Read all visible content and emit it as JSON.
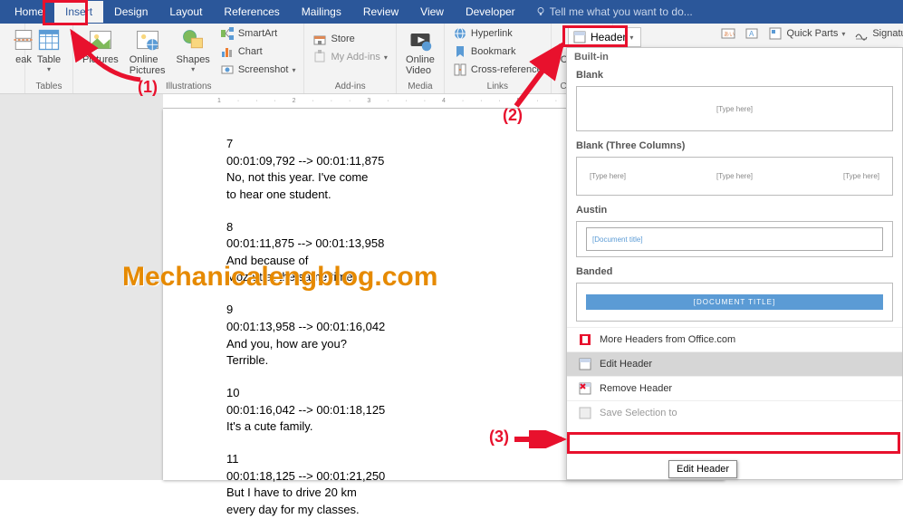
{
  "tabs": [
    "Home",
    "Insert",
    "Design",
    "Layout",
    "References",
    "Mailings",
    "Review",
    "View",
    "Developer"
  ],
  "tellme": "Tell me what you want to do...",
  "ribbon": {
    "pageBreak": "eak",
    "table": "Table",
    "pictures": "Pictures",
    "onlinePictures": "Online\nPictures",
    "shapes": "Shapes",
    "smartArt": "SmartArt",
    "chart": "Chart",
    "screenshot": "Screenshot",
    "store": "Store",
    "addins": "My Add-ins",
    "onlineVideo": "Online\nVideo",
    "hyperlink": "Hyperlink",
    "bookmark": "Bookmark",
    "crossref": "Cross-reference",
    "comment": "Comment",
    "quickParts": "Quick Parts",
    "signature": "Signature Line",
    "group_tables": "Tables",
    "group_illustrations": "Illustrations",
    "group_addins": "Add-ins",
    "group_media": "Media",
    "group_links": "Links",
    "group_comments": "Comments"
  },
  "headerBtn": "Header",
  "gallery": {
    "builtin": "Built-in",
    "blank": "Blank",
    "typeHere": "[Type here]",
    "blank3": "Blank (Three Columns)",
    "austin": "Austin",
    "docTitle": "[Document title]",
    "banded": "Banded",
    "bandedTitle": "[DOCUMENT TITLE]",
    "more": "More Headers from Office.com",
    "edit": "Edit Header",
    "remove": "Remove Header",
    "save": "Save Selection to"
  },
  "tooltip": "Edit Header",
  "doc": {
    "b1n": "7",
    "b1t": "00:01:09,792 --> 00:01:11,875",
    "b1l1": "No, not this year. I've come",
    "b1l2": "to hear one student.",
    "b2n": "8",
    "b2t": "00:01:11,875 --> 00:01:13,958",
    "b2l1": "And because of",
    "b2l2": "Mozart at the same time.",
    "b3n": "9",
    "b3t": "00:01:13,958 --> 00:01:16,042",
    "b3l1": "And you, how are you?",
    "b3l2": "Terrible.",
    "b4n": "10",
    "b4t": "00:01:16,042 --> 00:01:18,125",
    "b4l1": "It's a cute family.",
    "b5n": "11",
    "b5t": "00:01:18,125 --> 00:01:21,250",
    "b5l1": "But I have to drive 20 km",
    "b5l2": "every day for my classes."
  },
  "watermark": "Mechanicalengblog.com",
  "annot": {
    "a1": "(1)",
    "a2": "(2)",
    "a3": "(3)"
  },
  "ruler": "1 · · · 2 · · · 3 · · · 4 · · · 5 · · · 6"
}
